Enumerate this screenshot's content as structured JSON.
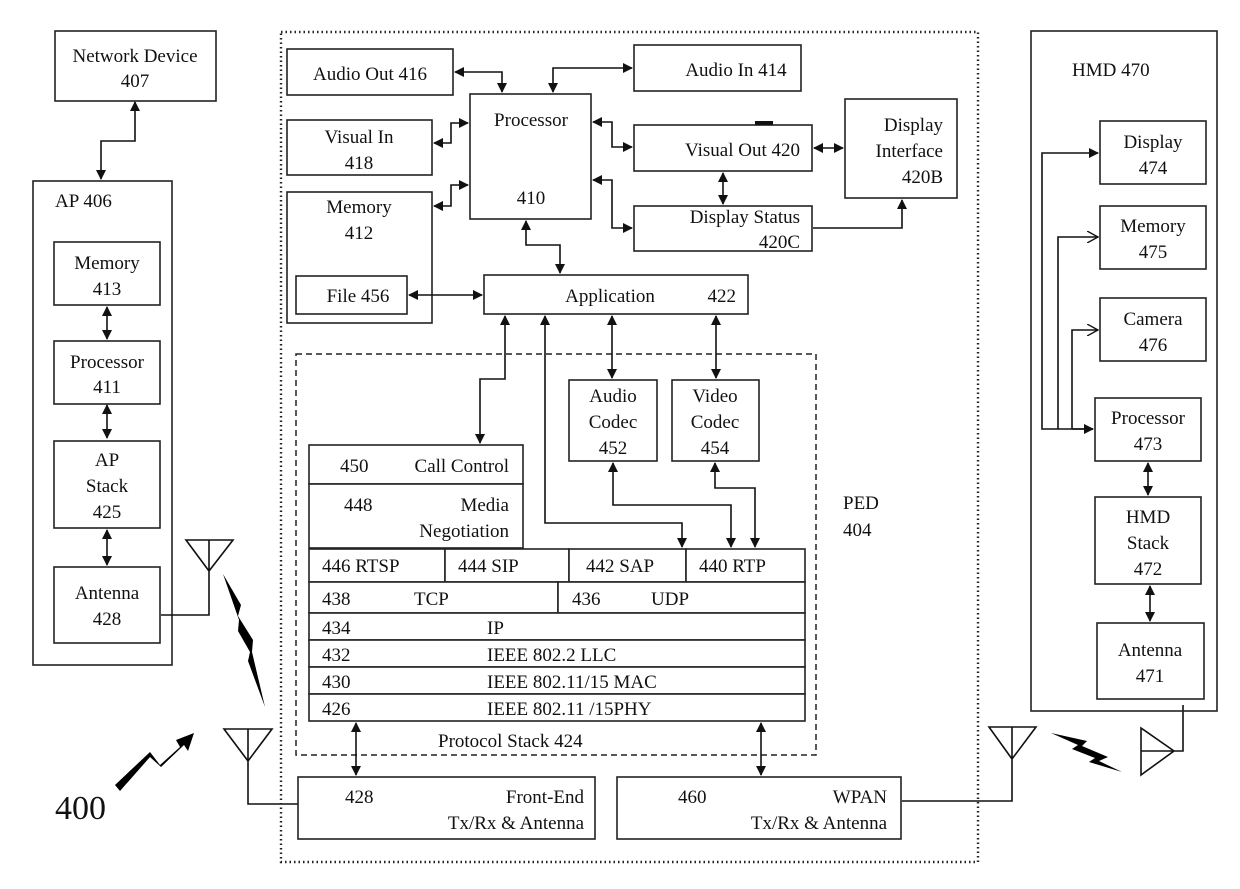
{
  "figure_label": "400",
  "network_device": {
    "title": "Network Device",
    "num": "407"
  },
  "ap": {
    "title": "AP 406",
    "memory": {
      "title": "Memory",
      "num": "413"
    },
    "processor": {
      "title": "Processor",
      "num": "411"
    },
    "stack": {
      "line1": "AP",
      "line2": "Stack",
      "num": "425"
    },
    "antenna": {
      "title": "Antenna",
      "num": "428"
    }
  },
  "ped": {
    "title": "PED",
    "num": "404",
    "audio_out": "Audio Out 416",
    "audio_in": "Audio In 414",
    "visual_in": {
      "title": "Visual In",
      "num": "418"
    },
    "processor": {
      "title": "Processor",
      "num": "410"
    },
    "visual_out": "Visual Out 420",
    "display_interface": {
      "line1": "Display",
      "line2": "Interface",
      "num": "420B"
    },
    "display_status": {
      "title": "Display Status",
      "num": "420C"
    },
    "memory": {
      "title": "Memory",
      "num": "412"
    },
    "file": "File 456",
    "application": {
      "title": "Application",
      "num": "422"
    },
    "audio_codec": {
      "line1": "Audio",
      "line2": "Codec",
      "num": "452"
    },
    "video_codec": {
      "line1": "Video",
      "line2": "Codec",
      "num": "454"
    },
    "protocol_stack": {
      "label": "Protocol Stack  424",
      "call_control": {
        "num": "450",
        "title": "Call Control"
      },
      "media_negotiation": {
        "num": "448",
        "line1": "Media",
        "line2": "Negotiation"
      },
      "app_protocols": [
        "446 RTSP",
        "444 SIP",
        "442 SAP",
        "440 RTP"
      ],
      "transport": [
        {
          "num": "438",
          "title": "TCP"
        },
        {
          "num": "436",
          "title": "UDP"
        }
      ],
      "layers": [
        {
          "num": "434",
          "title": "IP"
        },
        {
          "num": "432",
          "title": "IEEE 802.2 LLC"
        },
        {
          "num": "430",
          "title": "IEEE 802.11/15 MAC"
        },
        {
          "num": "426",
          "title": "IEEE 802.11 /15PHY"
        }
      ]
    },
    "front_end": {
      "num": "428",
      "line1": "Front-End",
      "line2": "Tx/Rx & Antenna"
    },
    "wpan": {
      "num": "460",
      "line1": "WPAN",
      "line2": "Tx/Rx & Antenna"
    }
  },
  "hmd": {
    "title": "HMD 470",
    "display": {
      "title": "Display",
      "num": "474"
    },
    "memory": {
      "title": "Memory",
      "num": "475"
    },
    "camera": {
      "title": "Camera",
      "num": "476"
    },
    "processor": {
      "title": "Processor",
      "num": "473"
    },
    "stack": {
      "line1": "HMD",
      "line2": "Stack",
      "num": "472"
    },
    "antenna": {
      "title": "Antenna",
      "num": "471"
    }
  }
}
